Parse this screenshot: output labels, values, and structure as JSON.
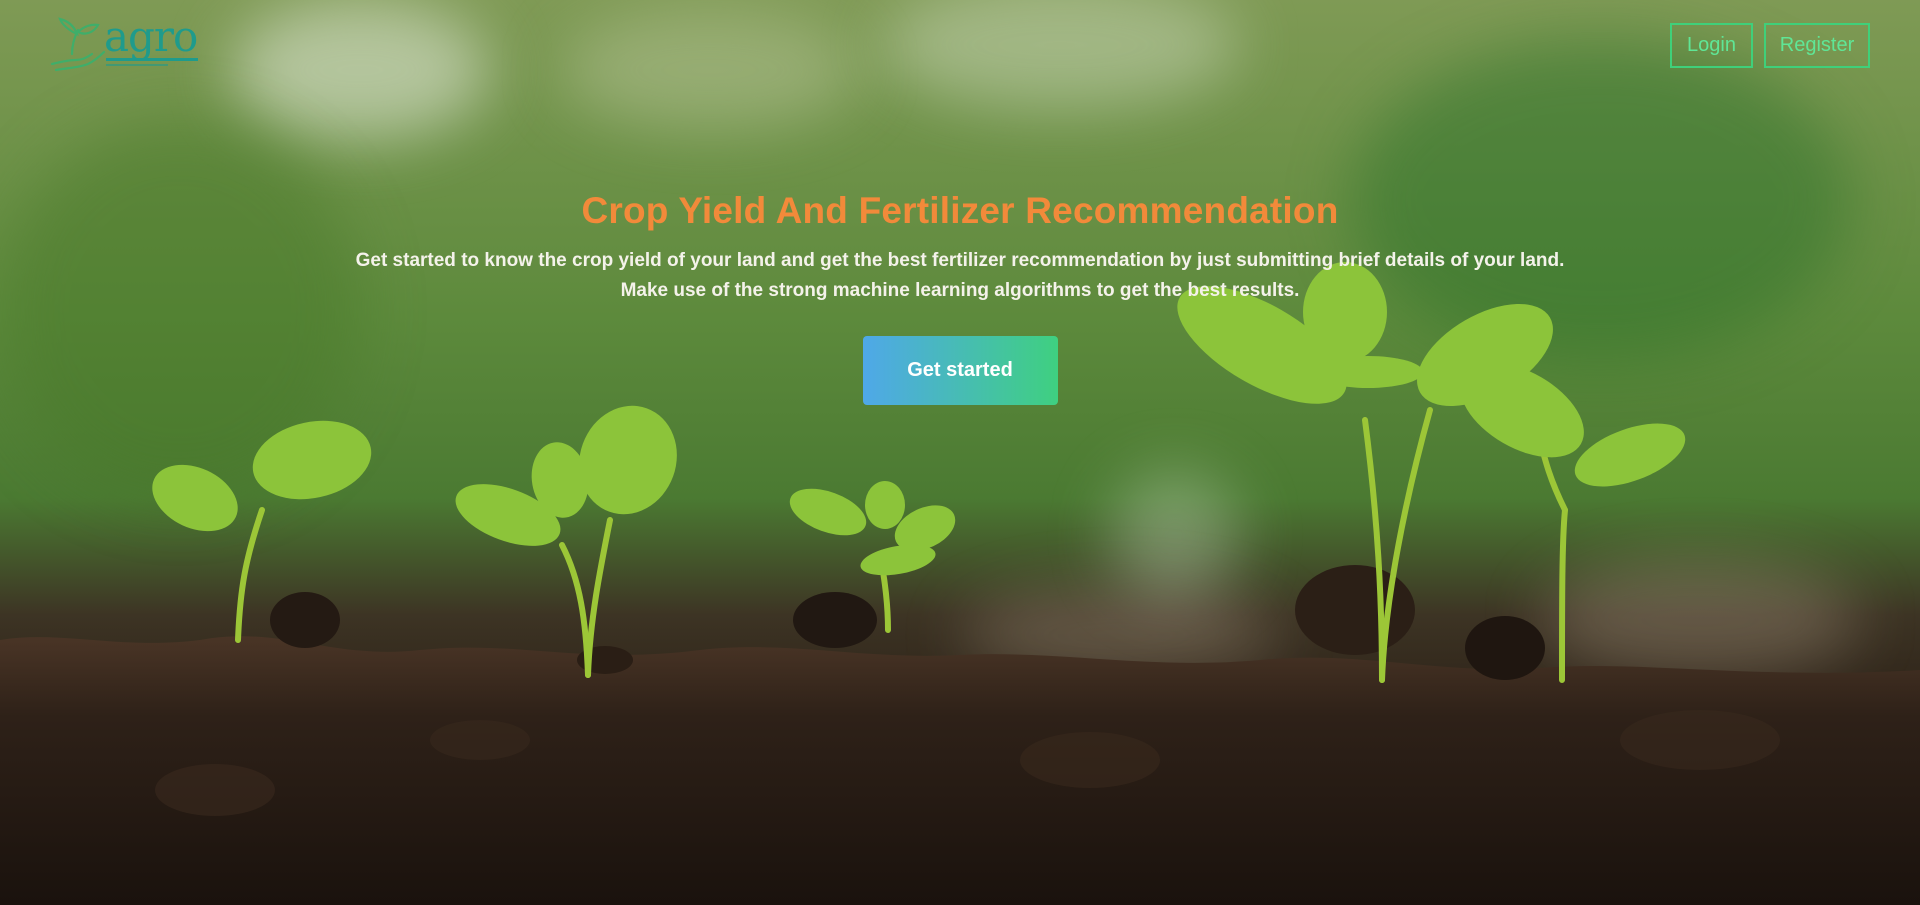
{
  "brand": {
    "name": "agro",
    "icon": "sprout-hand-icon",
    "color": "#1f9b8c"
  },
  "nav": {
    "login_label": "Login",
    "register_label": "Register",
    "accent": "#3fd07a"
  },
  "hero": {
    "title": "Crop Yield And Fertilizer Recommendation",
    "subtitle_line1": "Get started to know the crop yield of your land and get the best fertilizer recommendation by just submitting brief details of your land.",
    "subtitle_line2": "Make use of the strong machine learning algorithms to get the best results.",
    "cta_label": "Get started",
    "title_color": "#f28a3a"
  },
  "background": {
    "description_icon": "seedlings-in-soil-image"
  }
}
